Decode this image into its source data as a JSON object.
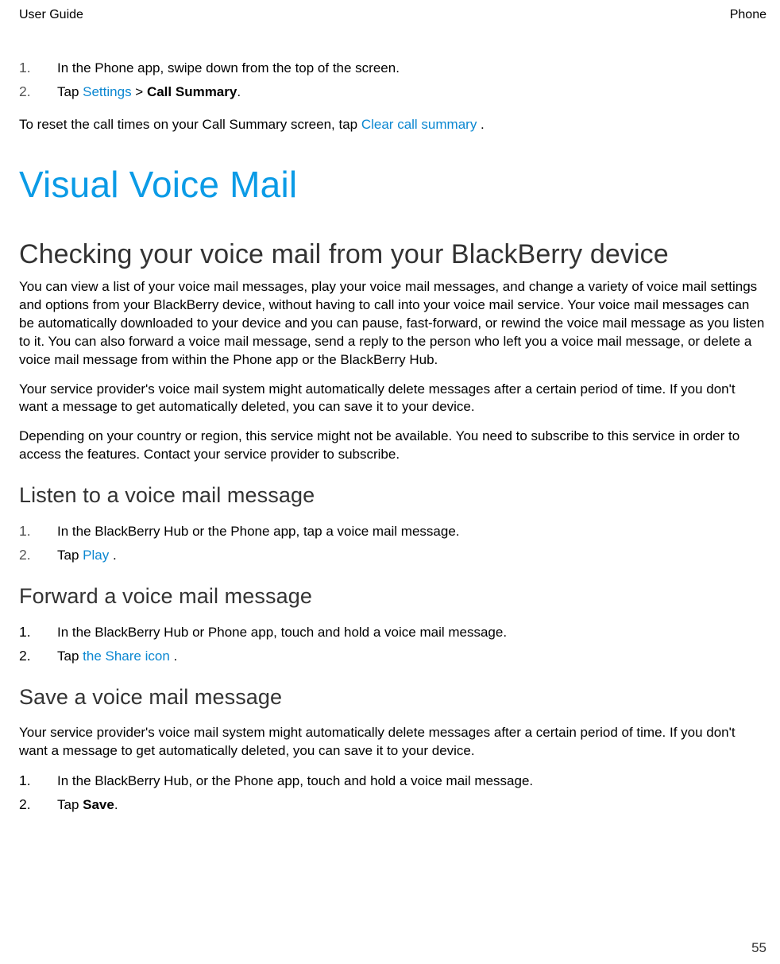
{
  "header": {
    "left": "User Guide",
    "right": "Phone"
  },
  "intro_list": [
    {
      "num": "1.",
      "plain": "In the Phone app, swipe down from the top of the screen."
    },
    {
      "num": "2.",
      "pre": "Tap  ",
      "link": "Settings",
      "mid": "  > ",
      "bold": "Call Summary",
      "post": "."
    }
  ],
  "intro_tail": {
    "pre": "To reset the call times on your Call Summary screen, tap  ",
    "link": "Clear call summary",
    "post": " ."
  },
  "h1": "Visual Voice Mail",
  "h2": "Checking your voice mail from your BlackBerry device",
  "paras": [
    "You can view a list of your voice mail messages, play your voice mail messages, and change a variety of voice mail settings and options from your BlackBerry device, without having to call into your voice mail service. Your voice mail messages can be automatically downloaded to your device and you can pause, fast-forward, or rewind the voice mail message as you listen to it. You can also forward a voice mail message, send a reply to the person who left you a voice mail message, or delete a voice mail message from within the Phone app or the BlackBerry Hub.",
    "Your service provider's voice mail system might automatically delete messages after a certain period of time. If you don't want a message to get automatically deleted, you can save it to your device.",
    "Depending on your country or region, this service might not be available. You need to subscribe to this service in order to access the features. Contact your service provider to subscribe."
  ],
  "listen": {
    "title": "Listen to a voice mail message",
    "items": [
      {
        "num": "1.",
        "plain": "In the BlackBerry Hub or the Phone app, tap a voice mail message."
      },
      {
        "num": "2.",
        "pre": "Tap  ",
        "link": "Play",
        "post": " ."
      }
    ]
  },
  "forward": {
    "title": "Forward a voice mail message",
    "items": [
      {
        "num": "1.",
        "plain": "In the BlackBerry Hub or Phone app, touch and hold a voice mail message."
      },
      {
        "num": "2.",
        "pre": "Tap  ",
        "link": "the Share icon",
        "post": " ."
      }
    ]
  },
  "save": {
    "title": "Save a voice mail message",
    "para": "Your service provider's voice mail system might automatically delete messages after a certain period of time. If you don't want a message to get automatically deleted, you can save it to your device.",
    "items": [
      {
        "num": "1.",
        "plain": "In the BlackBerry Hub, or the Phone app, touch and hold a voice mail message."
      },
      {
        "num": "2.",
        "pre": "Tap ",
        "bold": "Save",
        "post": "."
      }
    ]
  },
  "page_number": "55"
}
